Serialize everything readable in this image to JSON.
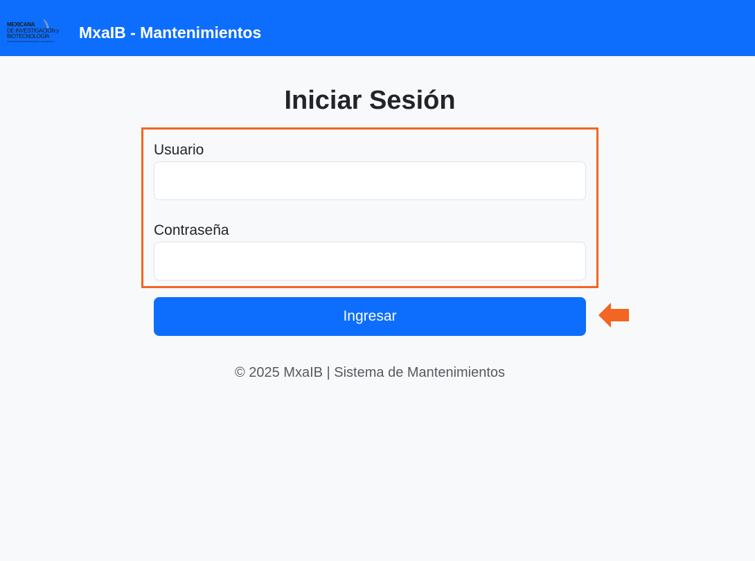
{
  "header": {
    "logo_lines": [
      "MEXICANA",
      "DE INVESTIGACIÓN y",
      "BIOTECNOLOGÍA",
      "INSTITUCIÓN DE INVESTIGACIÓN Y DESARROLLO"
    ],
    "brand": "MxaIB - Mantenimientos",
    "color": "#0d6efd"
  },
  "login": {
    "title": "Iniciar Sesión",
    "username_label": "Usuario",
    "username_value": "",
    "password_label": "Contraseña",
    "password_value": "",
    "submit_label": "Ingresar"
  },
  "annotation": {
    "highlight_color": "#f26522",
    "arrow_icon": "left-arrow-icon"
  },
  "footer": {
    "text": "© 2025 MxaIB | Sistema de Mantenimientos"
  }
}
